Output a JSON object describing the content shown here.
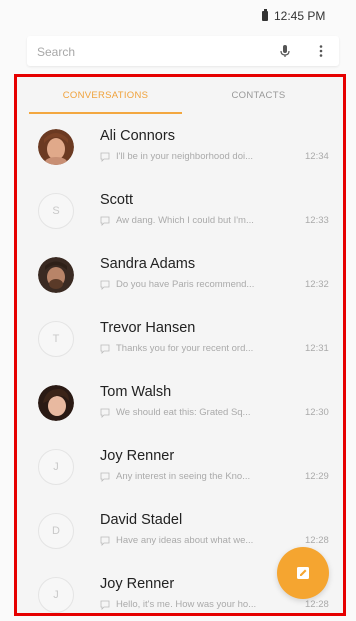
{
  "status_bar": {
    "time": "12:45 PM",
    "battery_icon": "battery-icon"
  },
  "search": {
    "placeholder": "Search",
    "mic_icon": "mic-icon",
    "more_icon": "more-vert-icon"
  },
  "tabs": [
    {
      "label": "CONVERSATIONS",
      "active": true
    },
    {
      "label": "CONTACTS",
      "active": false
    }
  ],
  "colors": {
    "accent": "#f3a73f",
    "frame_border": "#e60000"
  },
  "conversations": [
    {
      "name": "Ali Connors",
      "avatar_type": "photo",
      "avatar_letter": "",
      "preview": "I'll be in your neighborhood doi...",
      "time": "12:34"
    },
    {
      "name": "Scott",
      "avatar_type": "letter",
      "avatar_letter": "S",
      "preview": "Aw dang. Which I could but I'm...",
      "time": "12:33"
    },
    {
      "name": "Sandra Adams",
      "avatar_type": "photo",
      "avatar_letter": "",
      "preview": "Do you have Paris recommend...",
      "time": "12:32"
    },
    {
      "name": "Trevor Hansen",
      "avatar_type": "letter",
      "avatar_letter": "T",
      "preview": "Thanks you for your recent ord...",
      "time": "12:31"
    },
    {
      "name": "Tom Walsh",
      "avatar_type": "photo",
      "avatar_letter": "",
      "preview": "We should eat this: Grated Sq...",
      "time": "12:30"
    },
    {
      "name": "Joy Renner",
      "avatar_type": "letter",
      "avatar_letter": "J",
      "preview": "Any interest in seeing the Kno...",
      "time": "12:29"
    },
    {
      "name": "David Stadel",
      "avatar_type": "letter",
      "avatar_letter": "D",
      "preview": "Have any ideas about what we...",
      "time": "12:28"
    },
    {
      "name": "Joy Renner",
      "avatar_type": "letter",
      "avatar_letter": "J",
      "preview": "Hello, it's me. How was your ho...",
      "time": "12:28"
    }
  ],
  "fab": {
    "icon": "compose-icon"
  }
}
